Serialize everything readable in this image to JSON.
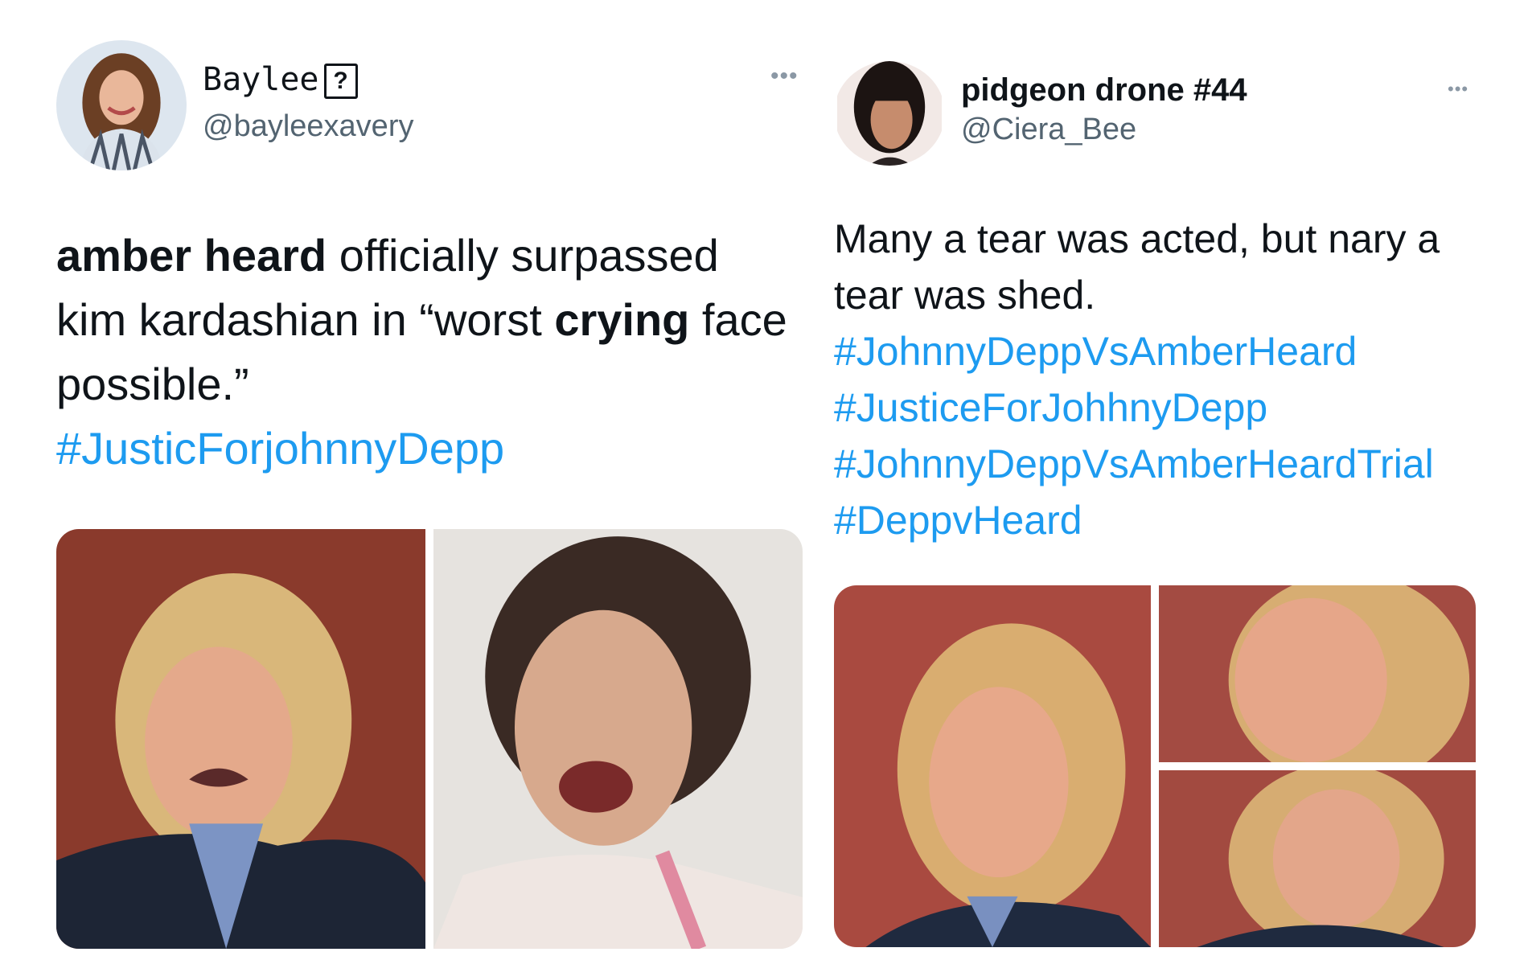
{
  "left_tweet": {
    "display_name": "Baylee",
    "name_badge": "?",
    "handle": "@bayleexavery",
    "more_icon": "more-horizontal-icon",
    "text_bold_1": "amber heard",
    "text_plain_1": " officially surpassed kim kardashian in “worst ",
    "text_bold_2": "crying",
    "text_plain_2": " face possible.”",
    "hashtag": "#JusticForjohnnyDepp",
    "media_alt": [
      "amber-heard-crying-photo",
      "kim-kardashian-crying-photo"
    ]
  },
  "right_tweet": {
    "display_name": "pidgeon drone #44",
    "handle": "@Ciera_Bee",
    "more_icon": "more-horizontal-icon",
    "text": "Many a tear was acted, but nary a tear was shed.",
    "hashtags": [
      "#JohnnyDeppVsAmberHeard",
      "#JusticeForJohhnyDepp",
      "#JohnnyDeppVsAmberHeardTrial",
      "#DeppvHeard"
    ],
    "media_alt": [
      "amber-heard-crying-photo-1",
      "amber-heard-crying-photo-2",
      "amber-heard-crying-photo-3"
    ]
  },
  "colors": {
    "link": "#1d9bf0",
    "secondary_text": "#536471",
    "primary_text": "#0f1419"
  }
}
